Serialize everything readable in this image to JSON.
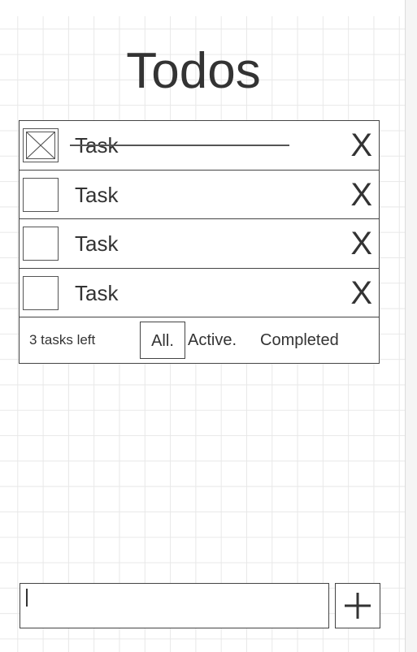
{
  "app": {
    "title": "Todos"
  },
  "tasks": [
    {
      "label": "Task",
      "completed": true,
      "delete_label": "X"
    },
    {
      "label": "Task",
      "completed": false,
      "delete_label": "X"
    },
    {
      "label": "Task",
      "completed": false,
      "delete_label": "X"
    },
    {
      "label": "Task",
      "completed": false,
      "delete_label": "X"
    }
  ],
  "footer": {
    "count_text": "3 tasks left",
    "filters": [
      {
        "label": "All.",
        "selected": true
      },
      {
        "label": "Active.",
        "selected": false
      },
      {
        "label": "Completed",
        "selected": false
      }
    ]
  },
  "new_task": {
    "value": "",
    "placeholder": ""
  },
  "icons": {
    "checkbox_checked": "checkbox-checked-icon",
    "add": "plus-icon"
  },
  "colors": {
    "ink": "#333333",
    "border": "#444444",
    "grid": "#e8e8e8",
    "background": "#ffffff"
  }
}
